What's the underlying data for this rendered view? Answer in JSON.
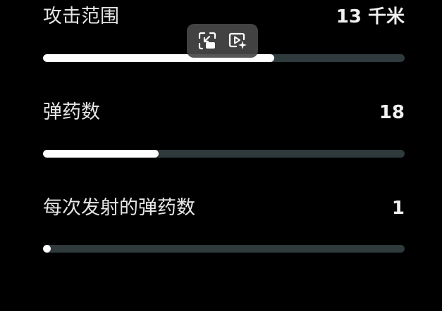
{
  "stats": [
    {
      "label": "攻击范围",
      "value": "13 千米",
      "progress": 0.64
    },
    {
      "label": "弹药数",
      "value": "18",
      "progress": 0.32
    },
    {
      "label": "每次发射的弹药数",
      "value": "1",
      "progress": 0.02
    },
    {
      "label": "",
      "value": ""
    }
  ],
  "toolbar": {
    "buttons": [
      {
        "icon": "picture-in-picture-icon"
      },
      {
        "icon": "video-ai-icon"
      }
    ]
  },
  "colors": {
    "background": "#000000",
    "track": "#2f3a3d",
    "fill": "#ffffff",
    "toolbar": "#484848"
  }
}
